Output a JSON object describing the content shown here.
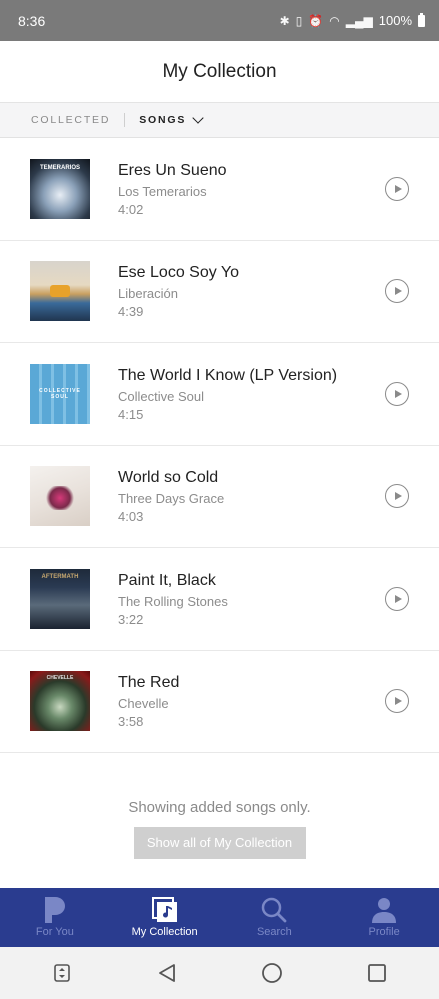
{
  "status": {
    "time": "8:36",
    "battery": "100%"
  },
  "header": {
    "title": "My Collection"
  },
  "filter": {
    "label": "COLLECTED",
    "selected": "SONGS"
  },
  "songs": [
    {
      "title": "Eres Un Sueno",
      "artist": "Los Temerarios",
      "duration": "4:02",
      "art_text": "TEMERARIOS"
    },
    {
      "title": "Ese Loco Soy Yo",
      "artist": "Liberación",
      "duration": "4:39",
      "art_text": ""
    },
    {
      "title": "The World I Know (LP Version)",
      "artist": "Collective Soul",
      "duration": "4:15",
      "art_text": "COLLECTIVE SOUL"
    },
    {
      "title": "World so Cold",
      "artist": "Three Days Grace",
      "duration": "4:03",
      "art_text": ""
    },
    {
      "title": "Paint It, Black",
      "artist": "The Rolling Stones",
      "duration": "3:22",
      "art_text": "AFTERMATH"
    },
    {
      "title": "The Red",
      "artist": "Chevelle",
      "duration": "3:58",
      "art_text": "CHEVELLE"
    }
  ],
  "footer": {
    "message": "Showing added songs only.",
    "show_all_label": "Show all of My Collection"
  },
  "tabs": [
    {
      "label": "For You",
      "icon": "pandora-p-icon"
    },
    {
      "label": "My Collection",
      "icon": "my-collection-icon"
    },
    {
      "label": "Search",
      "icon": "search-icon"
    },
    {
      "label": "Profile",
      "icon": "profile-icon"
    }
  ],
  "colors": {
    "tabbar": "#2a3c8f",
    "tab_inactive": "#7a87c6",
    "status_bar": "#7a7a7a"
  }
}
